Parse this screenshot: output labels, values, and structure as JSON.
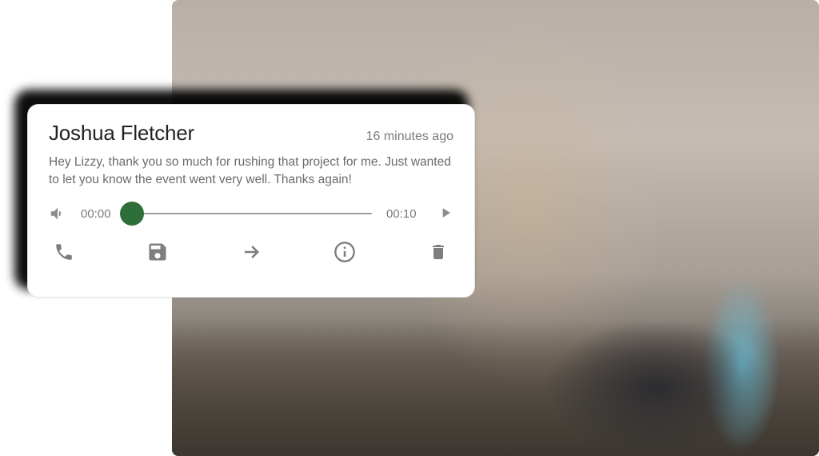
{
  "voicemail": {
    "caller_name": "Joshua Fletcher",
    "timestamp": "16 minutes ago",
    "transcript": "Hey Lizzy, thank you so much for rushing that project for me. Just wanted to let you know the event went very well. Thanks again!",
    "current_time": "00:00",
    "duration": "00:10"
  },
  "colors": {
    "slider_thumb": "#2e6e3a"
  }
}
